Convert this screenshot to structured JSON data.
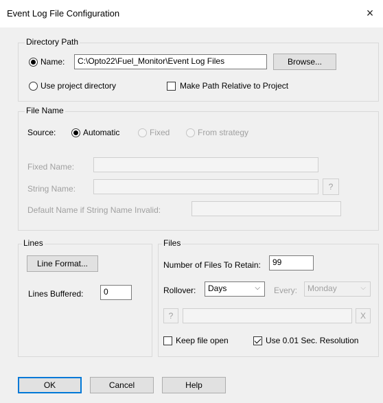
{
  "window": {
    "title": "Event Log File Configuration",
    "close": "×"
  },
  "directory_path": {
    "legend": "Directory Path",
    "name_label": "Name:",
    "name_value": "C:\\Opto22\\Fuel_Monitor\\Event Log Files",
    "browse_label": "Browse...",
    "use_project_label": "Use project directory",
    "make_relative_label": "Make Path Relative to Project",
    "name_selected": true,
    "make_relative_checked": false
  },
  "file_name": {
    "legend": "File Name",
    "source_label": "Source:",
    "automatic_label": "Automatic",
    "fixed_label": "Fixed",
    "from_strategy_label": "From strategy",
    "fixed_name_label": "Fixed Name:",
    "fixed_name_value": "",
    "string_name_label": "String Name:",
    "string_name_value": "",
    "question_label": "?",
    "default_name_label": "Default Name if String Name Invalid:",
    "default_name_value": ""
  },
  "lines": {
    "legend": "Lines",
    "line_format_label": "Line Format...",
    "lines_buffered_label": "Lines Buffered:",
    "lines_buffered_value": "0"
  },
  "files": {
    "legend": "Files",
    "retain_label": "Number of Files To Retain:",
    "retain_value": "99",
    "rollover_label": "Rollover:",
    "rollover_value": "Days",
    "every_label": "Every:",
    "every_value": "Monday",
    "question_label": "?",
    "path_value": "",
    "clear_label": "X",
    "keep_open_label": "Keep file open",
    "keep_open_checked": false,
    "resolution_label": "Use 0.01 Sec. Resolution",
    "resolution_checked": true
  },
  "buttons": {
    "ok": "OK",
    "cancel": "Cancel",
    "help": "Help"
  },
  "icons": {
    "chevron": "chevron-down-icon",
    "close": "close-icon"
  }
}
